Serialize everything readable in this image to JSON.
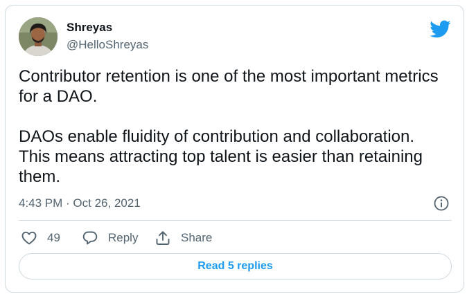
{
  "author": {
    "name": "Shreyas",
    "handle": "@HelloShreyas",
    "avatar_icon": "profile-photo"
  },
  "brand": {
    "logo_icon": "twitter-bird-icon",
    "accent_color": "#1d9bf0"
  },
  "tweet": {
    "paragraphs": [
      "Contributor retention is one of the most important metrics for a DAO.",
      "DAOs enable fluidity of contribution and collaboration. This means attracting top talent is easier than retaining them."
    ],
    "timestamp": "4:43 PM · Oct 26, 2021"
  },
  "actions": {
    "like": {
      "icon": "heart-icon",
      "count": "49"
    },
    "reply": {
      "icon": "reply-bubble-icon",
      "label": "Reply"
    },
    "share": {
      "icon": "share-upload-icon",
      "label": "Share"
    },
    "info_icon": "info-icon"
  },
  "footer": {
    "read_replies_label": "Read 5 replies"
  }
}
